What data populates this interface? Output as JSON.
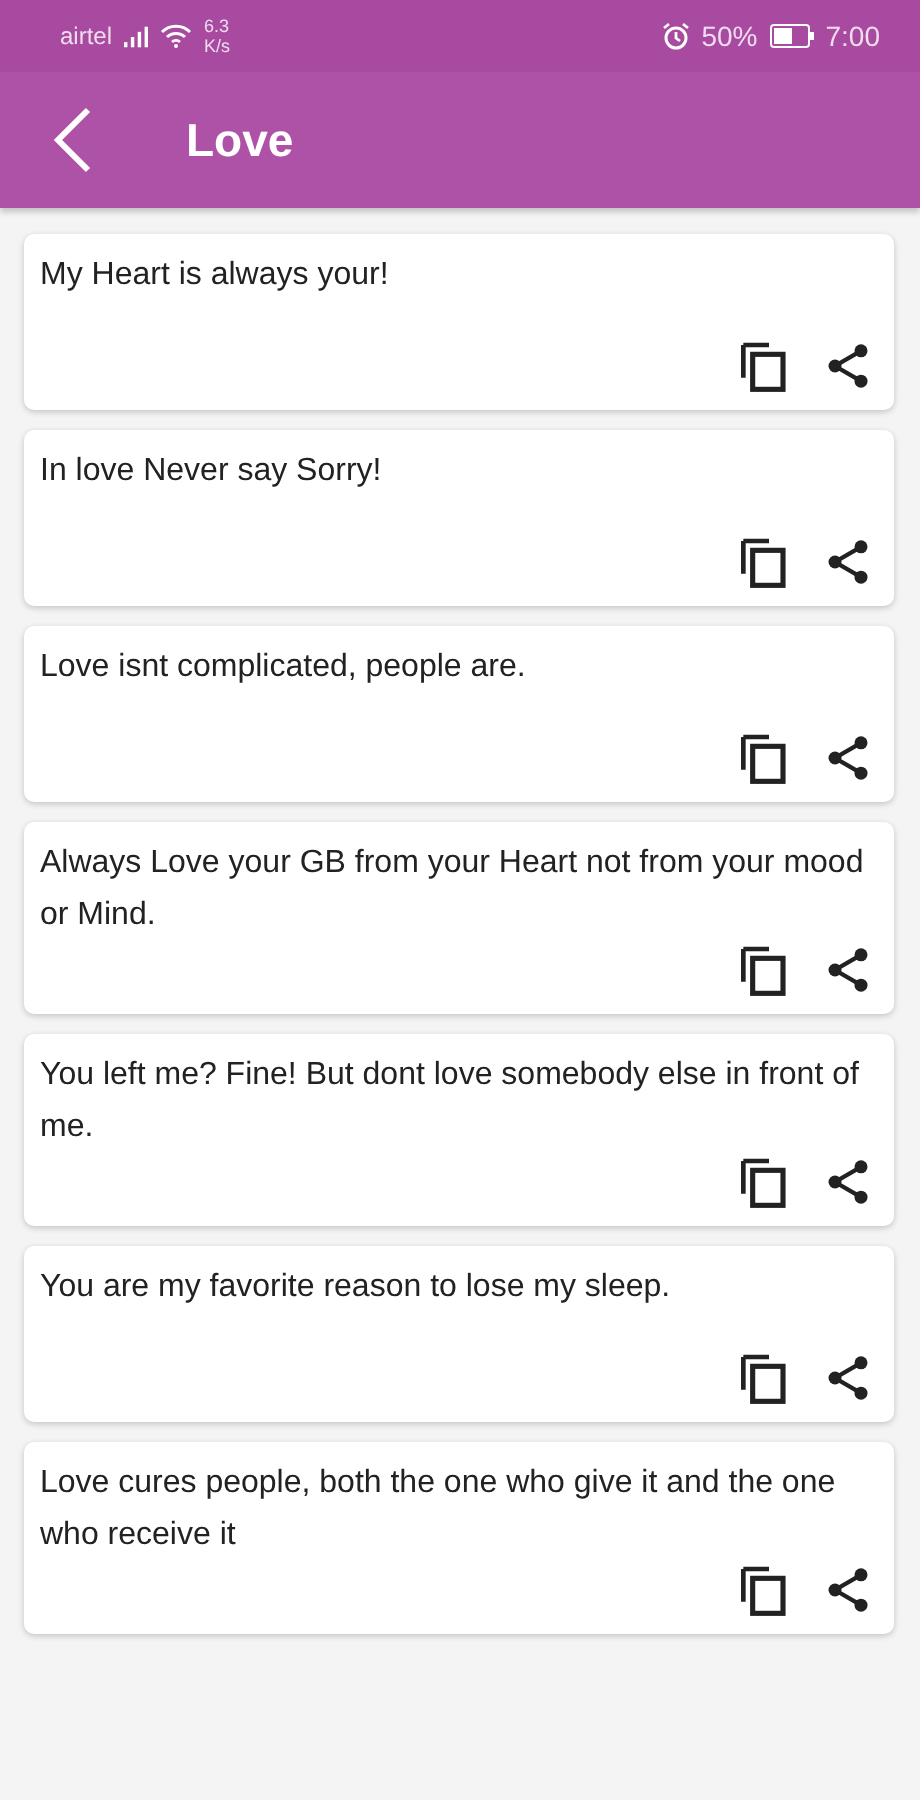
{
  "status_bar": {
    "carrier": "airtel",
    "speed_value": "6.3",
    "speed_unit": "K/s",
    "battery": "50%",
    "time": "7:00"
  },
  "app_bar": {
    "title": "Love"
  },
  "quotes": [
    {
      "text": "My Heart is always your!"
    },
    {
      "text": "In love Never say Sorry!"
    },
    {
      "text": "Love isnt complicated, people are."
    },
    {
      "text": "Always Love your GB from your Heart not from your mood or Mind."
    },
    {
      "text": "You left me? Fine! But dont love somebody else in front of me."
    },
    {
      "text": "You are my favorite reason to lose my sleep."
    },
    {
      "text": "Love cures people, both the one who give it and the one who receive it"
    }
  ]
}
